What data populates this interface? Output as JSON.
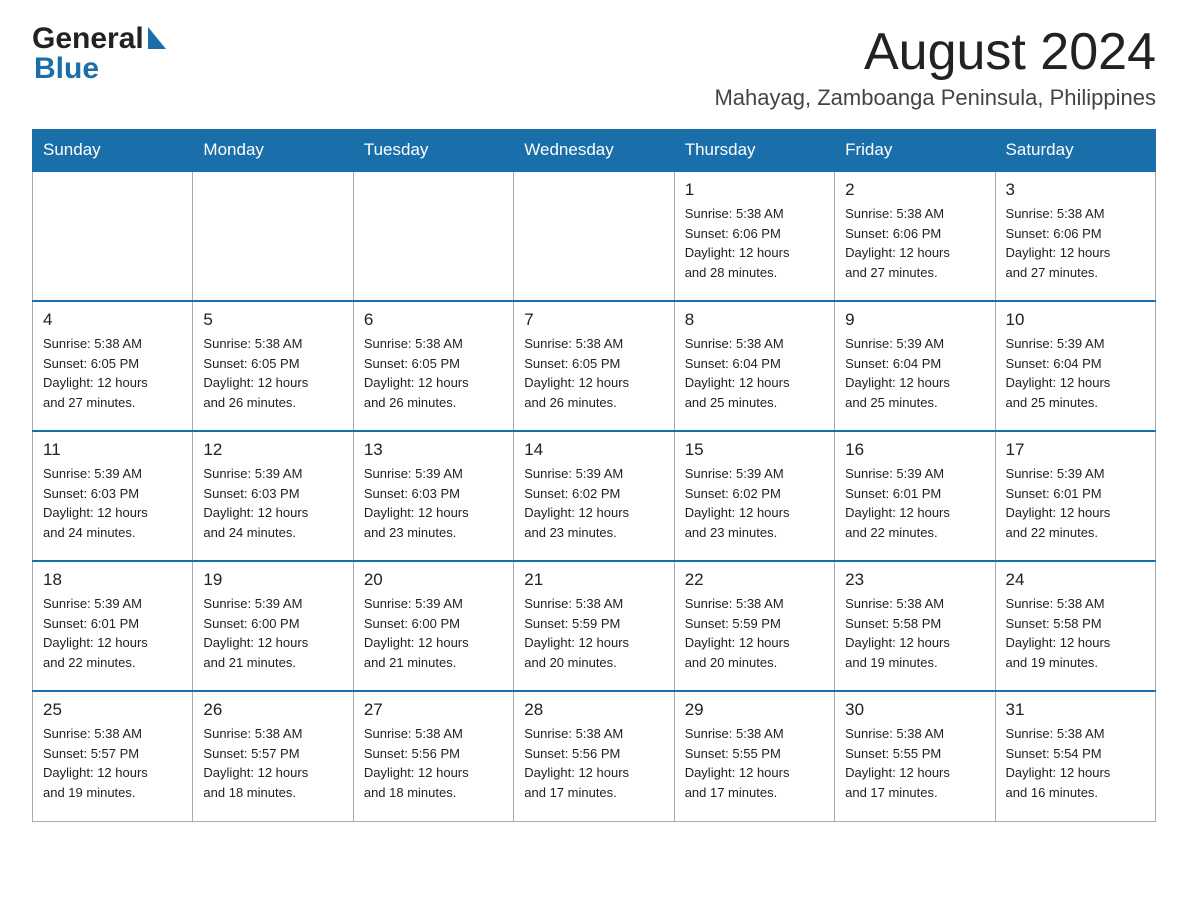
{
  "header": {
    "logo_general": "General",
    "logo_blue": "Blue",
    "month_title": "August 2024",
    "location": "Mahayag, Zamboanga Peninsula, Philippines"
  },
  "weekdays": [
    "Sunday",
    "Monday",
    "Tuesday",
    "Wednesday",
    "Thursday",
    "Friday",
    "Saturday"
  ],
  "weeks": [
    [
      {
        "day": "",
        "info": ""
      },
      {
        "day": "",
        "info": ""
      },
      {
        "day": "",
        "info": ""
      },
      {
        "day": "",
        "info": ""
      },
      {
        "day": "1",
        "info": "Sunrise: 5:38 AM\nSunset: 6:06 PM\nDaylight: 12 hours\nand 28 minutes."
      },
      {
        "day": "2",
        "info": "Sunrise: 5:38 AM\nSunset: 6:06 PM\nDaylight: 12 hours\nand 27 minutes."
      },
      {
        "day": "3",
        "info": "Sunrise: 5:38 AM\nSunset: 6:06 PM\nDaylight: 12 hours\nand 27 minutes."
      }
    ],
    [
      {
        "day": "4",
        "info": "Sunrise: 5:38 AM\nSunset: 6:05 PM\nDaylight: 12 hours\nand 27 minutes."
      },
      {
        "day": "5",
        "info": "Sunrise: 5:38 AM\nSunset: 6:05 PM\nDaylight: 12 hours\nand 26 minutes."
      },
      {
        "day": "6",
        "info": "Sunrise: 5:38 AM\nSunset: 6:05 PM\nDaylight: 12 hours\nand 26 minutes."
      },
      {
        "day": "7",
        "info": "Sunrise: 5:38 AM\nSunset: 6:05 PM\nDaylight: 12 hours\nand 26 minutes."
      },
      {
        "day": "8",
        "info": "Sunrise: 5:38 AM\nSunset: 6:04 PM\nDaylight: 12 hours\nand 25 minutes."
      },
      {
        "day": "9",
        "info": "Sunrise: 5:39 AM\nSunset: 6:04 PM\nDaylight: 12 hours\nand 25 minutes."
      },
      {
        "day": "10",
        "info": "Sunrise: 5:39 AM\nSunset: 6:04 PM\nDaylight: 12 hours\nand 25 minutes."
      }
    ],
    [
      {
        "day": "11",
        "info": "Sunrise: 5:39 AM\nSunset: 6:03 PM\nDaylight: 12 hours\nand 24 minutes."
      },
      {
        "day": "12",
        "info": "Sunrise: 5:39 AM\nSunset: 6:03 PM\nDaylight: 12 hours\nand 24 minutes."
      },
      {
        "day": "13",
        "info": "Sunrise: 5:39 AM\nSunset: 6:03 PM\nDaylight: 12 hours\nand 23 minutes."
      },
      {
        "day": "14",
        "info": "Sunrise: 5:39 AM\nSunset: 6:02 PM\nDaylight: 12 hours\nand 23 minutes."
      },
      {
        "day": "15",
        "info": "Sunrise: 5:39 AM\nSunset: 6:02 PM\nDaylight: 12 hours\nand 23 minutes."
      },
      {
        "day": "16",
        "info": "Sunrise: 5:39 AM\nSunset: 6:01 PM\nDaylight: 12 hours\nand 22 minutes."
      },
      {
        "day": "17",
        "info": "Sunrise: 5:39 AM\nSunset: 6:01 PM\nDaylight: 12 hours\nand 22 minutes."
      }
    ],
    [
      {
        "day": "18",
        "info": "Sunrise: 5:39 AM\nSunset: 6:01 PM\nDaylight: 12 hours\nand 22 minutes."
      },
      {
        "day": "19",
        "info": "Sunrise: 5:39 AM\nSunset: 6:00 PM\nDaylight: 12 hours\nand 21 minutes."
      },
      {
        "day": "20",
        "info": "Sunrise: 5:39 AM\nSunset: 6:00 PM\nDaylight: 12 hours\nand 21 minutes."
      },
      {
        "day": "21",
        "info": "Sunrise: 5:38 AM\nSunset: 5:59 PM\nDaylight: 12 hours\nand 20 minutes."
      },
      {
        "day": "22",
        "info": "Sunrise: 5:38 AM\nSunset: 5:59 PM\nDaylight: 12 hours\nand 20 minutes."
      },
      {
        "day": "23",
        "info": "Sunrise: 5:38 AM\nSunset: 5:58 PM\nDaylight: 12 hours\nand 19 minutes."
      },
      {
        "day": "24",
        "info": "Sunrise: 5:38 AM\nSunset: 5:58 PM\nDaylight: 12 hours\nand 19 minutes."
      }
    ],
    [
      {
        "day": "25",
        "info": "Sunrise: 5:38 AM\nSunset: 5:57 PM\nDaylight: 12 hours\nand 19 minutes."
      },
      {
        "day": "26",
        "info": "Sunrise: 5:38 AM\nSunset: 5:57 PM\nDaylight: 12 hours\nand 18 minutes."
      },
      {
        "day": "27",
        "info": "Sunrise: 5:38 AM\nSunset: 5:56 PM\nDaylight: 12 hours\nand 18 minutes."
      },
      {
        "day": "28",
        "info": "Sunrise: 5:38 AM\nSunset: 5:56 PM\nDaylight: 12 hours\nand 17 minutes."
      },
      {
        "day": "29",
        "info": "Sunrise: 5:38 AM\nSunset: 5:55 PM\nDaylight: 12 hours\nand 17 minutes."
      },
      {
        "day": "30",
        "info": "Sunrise: 5:38 AM\nSunset: 5:55 PM\nDaylight: 12 hours\nand 17 minutes."
      },
      {
        "day": "31",
        "info": "Sunrise: 5:38 AM\nSunset: 5:54 PM\nDaylight: 12 hours\nand 16 minutes."
      }
    ]
  ]
}
